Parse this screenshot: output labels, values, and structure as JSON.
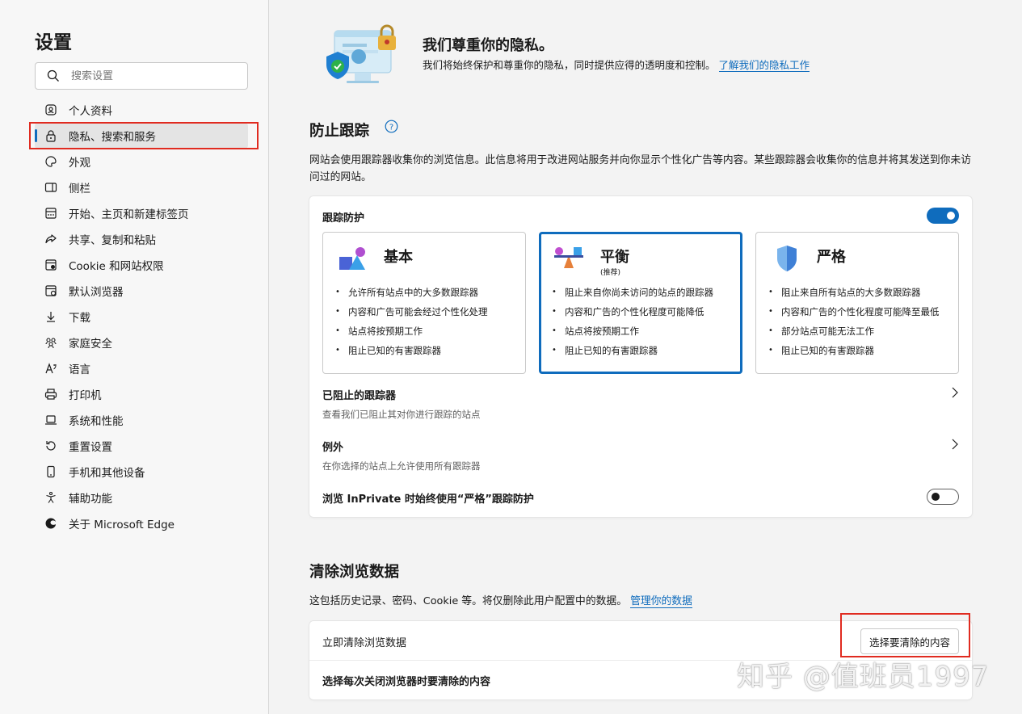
{
  "sidebar": {
    "title": "设置",
    "search_placeholder": "搜索设置",
    "items": [
      {
        "label": "个人资料",
        "icon": "profile-icon"
      },
      {
        "label": "隐私、搜索和服务",
        "icon": "lock-icon",
        "active": true
      },
      {
        "label": "外观",
        "icon": "palette-icon"
      },
      {
        "label": "侧栏",
        "icon": "sidebar-icon"
      },
      {
        "label": "开始、主页和新建标签页",
        "icon": "home-grid-icon"
      },
      {
        "label": "共享、复制和粘贴",
        "icon": "share-icon"
      },
      {
        "label": "Cookie 和网站权限",
        "icon": "site-permissions-icon"
      },
      {
        "label": "默认浏览器",
        "icon": "browser-icon"
      },
      {
        "label": "下载",
        "icon": "download-icon"
      },
      {
        "label": "家庭安全",
        "icon": "family-icon"
      },
      {
        "label": "语言",
        "icon": "language-icon"
      },
      {
        "label": "打印机",
        "icon": "printer-icon"
      },
      {
        "label": "系统和性能",
        "icon": "laptop-icon"
      },
      {
        "label": "重置设置",
        "icon": "reset-icon"
      },
      {
        "label": "手机和其他设备",
        "icon": "phone-icon"
      },
      {
        "label": "辅助功能",
        "icon": "accessibility-icon"
      },
      {
        "label": "关于 Microsoft Edge",
        "icon": "edge-logo-icon"
      }
    ]
  },
  "hero": {
    "title": "我们尊重你的隐私。",
    "desc": "我们将始终保护和尊重你的隐私，同时提供应得的透明度和控制。",
    "link": "了解我们的隐私工作"
  },
  "tracking": {
    "title": "防止跟踪",
    "desc": "网站会使用跟踪器收集你的浏览信息。此信息将用于改进网站服务并向你显示个性化广告等内容。某些跟踪器会收集你的信息并将其发送到你未访问过的网站。",
    "protection_label": "跟踪防护",
    "protection_on": true,
    "options": [
      {
        "name": "基本",
        "tag": "",
        "bullets": [
          "允许所有站点中的大多数跟踪器",
          "内容和广告可能会经过个性化处理",
          "站点将按预期工作",
          "阻止已知的有害跟踪器"
        ]
      },
      {
        "name": "平衡",
        "tag": "(推荐)",
        "selected": true,
        "bullets": [
          "阻止来自你尚未访问的站点的跟踪器",
          "内容和广告的个性化程度可能降低",
          "站点将按预期工作",
          "阻止已知的有害跟踪器"
        ]
      },
      {
        "name": "严格",
        "tag": "",
        "bullets": [
          "阻止来自所有站点的大多数跟踪器",
          "内容和广告的个性化程度可能降至最低",
          "部分站点可能无法工作",
          "阻止已知的有害跟踪器"
        ]
      }
    ],
    "blocked_title": "已阻止的跟踪器",
    "blocked_sub": "查看我们已阻止其对你进行跟踪的站点",
    "exceptions_title": "例外",
    "exceptions_sub": "在你选择的站点上允许使用所有跟踪器",
    "inprivate_label": "浏览 InPrivate 时始终使用“严格”跟踪防护",
    "inprivate_on": false
  },
  "clear": {
    "title": "清除浏览数据",
    "desc": "这包括历史记录、密码、Cookie 等。将仅删除此用户配置中的数据。",
    "link": "管理你的数据",
    "now_label": "立即清除浏览数据",
    "now_button": "选择要清除的内容",
    "onclose_label": "选择每次关闭浏览器时要清除的内容"
  },
  "watermark": "知乎 @值班员1997",
  "colors": {
    "accent": "#0f6cbd",
    "highlight_box": "#e02b20"
  }
}
